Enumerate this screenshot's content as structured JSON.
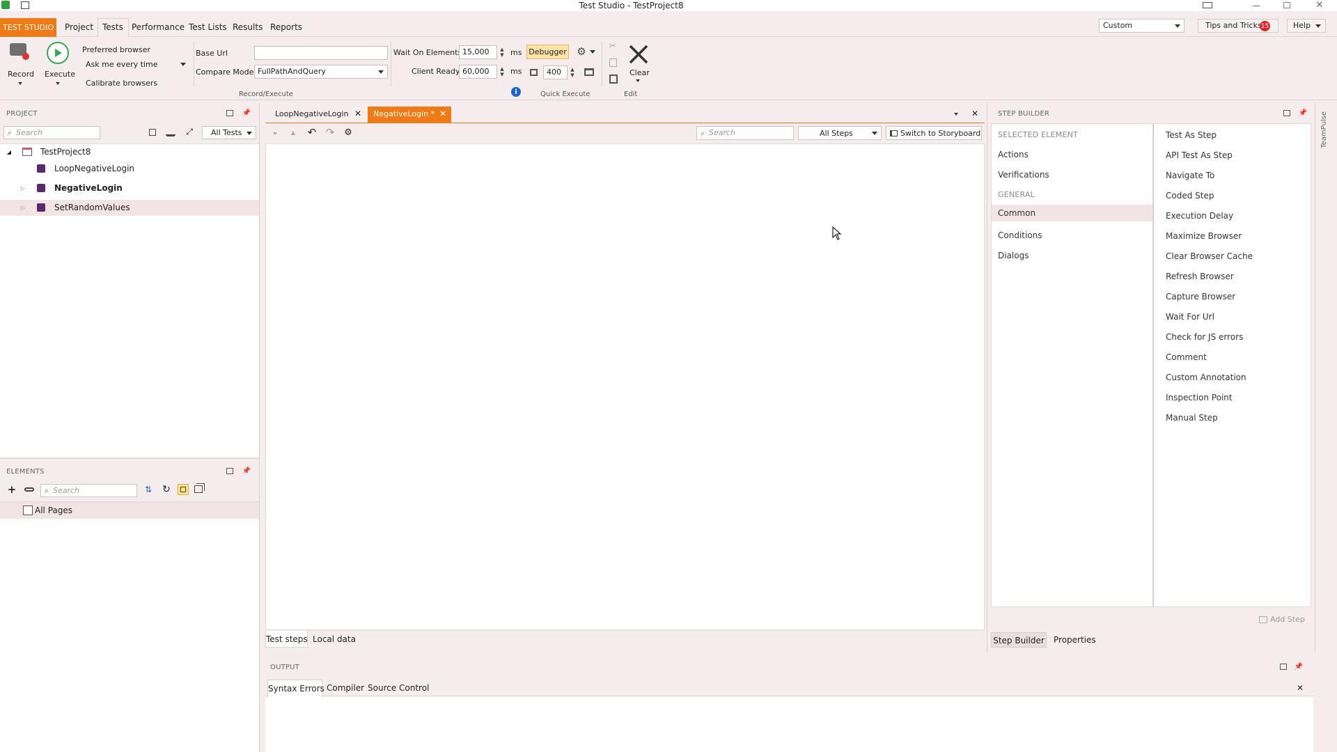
{
  "app": {
    "title": "Test Studio - TestProject8",
    "brand": "TEST STUDIO",
    "brand_color": "#f07b16"
  },
  "ribbon_tabs": [
    "Project",
    "Tests",
    "Performance",
    "Test Lists",
    "Results",
    "Reports"
  ],
  "top_right": {
    "layout_select": "Custom",
    "tips_label": "Tips and Tricks",
    "tips_count": "15",
    "help_label": "Help"
  },
  "ribbon": {
    "record_label": "Record",
    "execute_label": "Execute",
    "preferred_browser_label": "Preferred browser",
    "preferred_browser_value": "Ask me every time",
    "calibrate_label": "Calibrate browsers",
    "base_url_label": "Base Url",
    "base_url_value": "",
    "compare_mode_label": "Compare Mode",
    "compare_mode_value": "FullPathAndQuery",
    "wait_elements_label": "Wait On Elements",
    "wait_elements_value": "15,000",
    "client_ready_label": "Client Ready",
    "client_ready_value": "60,000",
    "ms_unit": "ms",
    "debugger_label": "Debugger",
    "speed_value": "400",
    "clear_label": "Clear",
    "group_record": "Record/Execute",
    "group_quick": "Quick Execute",
    "group_edit": "Edit"
  },
  "project": {
    "title": "PROJECT",
    "search_placeholder": "Search",
    "filter": "All Tests",
    "root": "TestProject8",
    "items": [
      "LoopNegativeLogin",
      "NegativeLogin",
      "SetRandomValues"
    ]
  },
  "elements": {
    "title": "ELEMENTS",
    "search_placeholder": "Search",
    "root": "All Pages"
  },
  "editor": {
    "tabs": [
      "LoopNegativeLogin",
      "NegativeLogin *"
    ],
    "search_placeholder": "Search",
    "steps_filter": "All Steps",
    "storyboard_label": "Switch to Storyboard",
    "bottom_tabs": [
      "Test steps",
      "Local data"
    ]
  },
  "step_builder": {
    "title": "STEP BUILDER",
    "selected_header": "SELECTED ELEMENT",
    "selected_items": [
      "Actions",
      "Verifications"
    ],
    "general_header": "GENERAL",
    "general_items": [
      "Common",
      "Conditions",
      "Dialogs"
    ],
    "steps": [
      "Test As Step",
      "API Test As Step",
      "Navigate To",
      "Coded Step",
      "Execution Delay",
      "Maximize Browser",
      "Clear Browser Cache",
      "Refresh Browser",
      "Capture Browser",
      "Wait For Url",
      "Check for JS errors",
      "Comment",
      "Custom Annotation",
      "Inspection Point",
      "Manual Step"
    ],
    "add_step_label": "Add Step",
    "bottom_tabs": [
      "Step Builder",
      "Properties"
    ],
    "side_label": "TeamPulse"
  },
  "output": {
    "title": "OUTPUT",
    "tabs": [
      "Syntax Errors",
      "Compiler",
      "Source Control"
    ]
  }
}
